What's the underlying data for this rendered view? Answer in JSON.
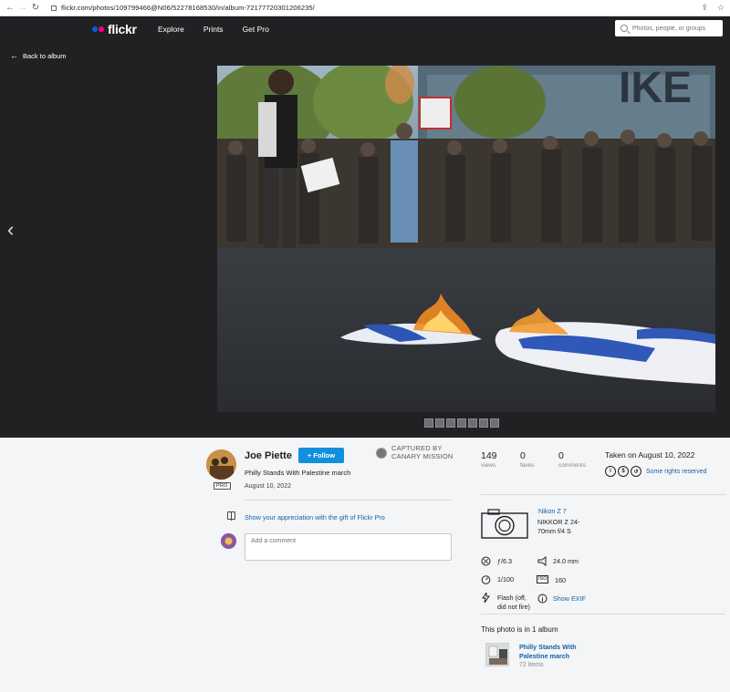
{
  "browser": {
    "url": "flickr.com/photos/109799466@N06/52278168530/in/album-72177720301206235/"
  },
  "header": {
    "logo_text": "flickr",
    "nav": [
      "Explore",
      "Prints",
      "Get Pro"
    ],
    "search_placeholder": "Photos, people, or groups"
  },
  "stage": {
    "back_label": "Back to album",
    "prev_glyph": "‹"
  },
  "owner": {
    "name": "Joe Piette",
    "pro_label": "PRO",
    "follow_label": "+ Follow"
  },
  "photo": {
    "title": "Philly Stands With Palestine march",
    "date": "August 10, 2022"
  },
  "watermark": {
    "line1": "CAPTURED BY",
    "line2": "CANARY MISSION"
  },
  "stats": [
    {
      "num": "149",
      "label": "views"
    },
    {
      "num": "0",
      "label": "faves"
    },
    {
      "num": "0",
      "label": "comments"
    }
  ],
  "taken": "Taken on August 10, 2022",
  "license_text": "Some rights reserved",
  "gift_text": "Show your appreciation with the gift of Flickr Pro",
  "comment_placeholder": "Add a comment",
  "camera": {
    "model": "Nikon Z 7",
    "lens": "NIKKOR Z 24-70mm f/4 S"
  },
  "exif": {
    "aperture": "ƒ/6.3",
    "focal": "24.0 mm",
    "shutter": "1/100",
    "iso": "160",
    "iso_label": "ISO",
    "flash": "Flash (off, did not fire)",
    "show_exif": "Show EXIF"
  },
  "album": {
    "heading": "This photo is in 1 album",
    "title": "Philly Stands With Palestine march",
    "count": "72 items"
  },
  "colors": {
    "flickr_blue": "#0063dc",
    "flickr_pink": "#ff0084",
    "follow_button": "#128fdc",
    "link": "#1a5fa8",
    "dark_bg": "#212124"
  }
}
